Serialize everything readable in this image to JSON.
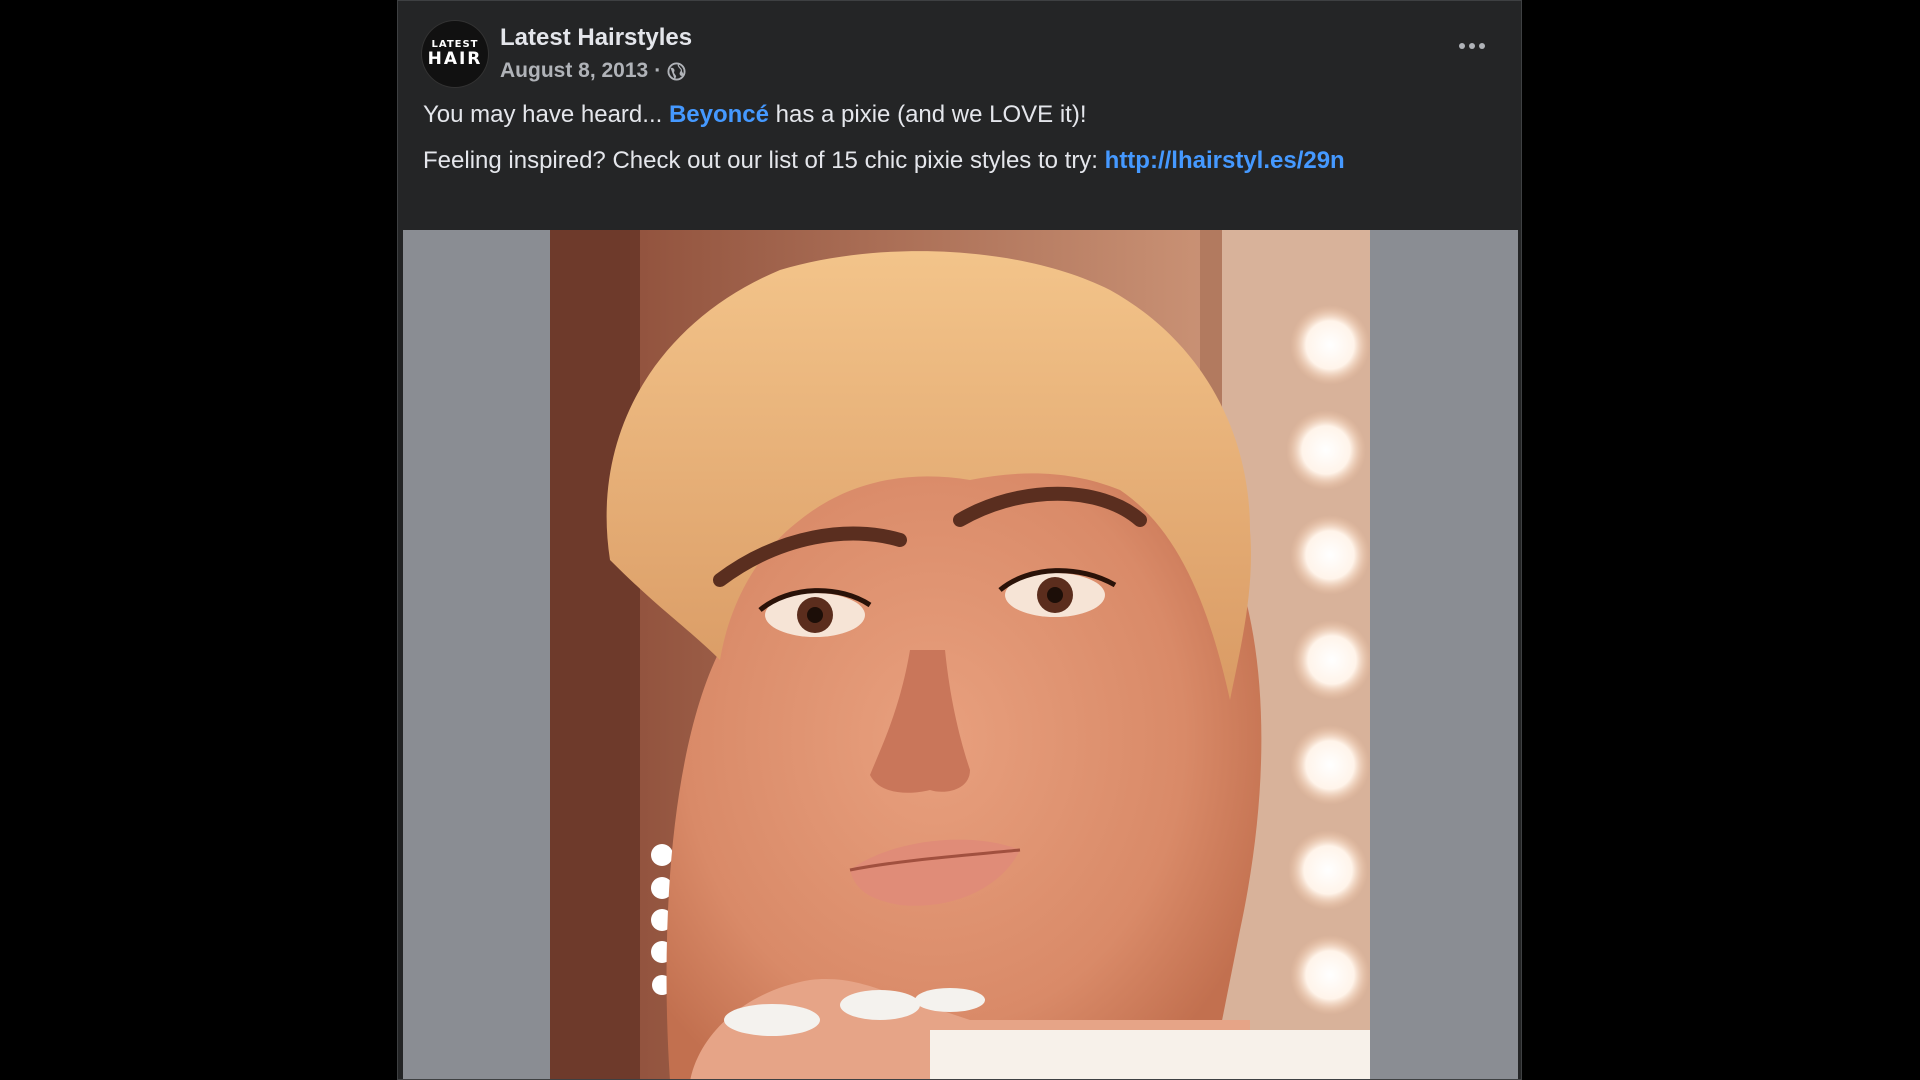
{
  "post": {
    "page_name": "Latest Hairstyles",
    "avatar": {
      "line1": "LATEST",
      "line2": "HAIR"
    },
    "date": "August 8, 2013",
    "separator": "·",
    "audience_icon": "globe-icon",
    "more_icon": "more-options-icon",
    "text": {
      "line1_before": "You may have heard... ",
      "mention": "Beyoncé",
      "line1_after": " has a pixie (and we LOVE it)!",
      "line2_before": "Feeling inspired? Check out our list of 15 chic pixie styles to try: ",
      "url": "http://lhairstyl.es/29n"
    },
    "colors": {
      "background": "#242526",
      "text": "#e4e6eb",
      "secondary_text": "#b0b3b8",
      "link": "#4599ff",
      "media_backdrop": "#8a8d93"
    }
  }
}
